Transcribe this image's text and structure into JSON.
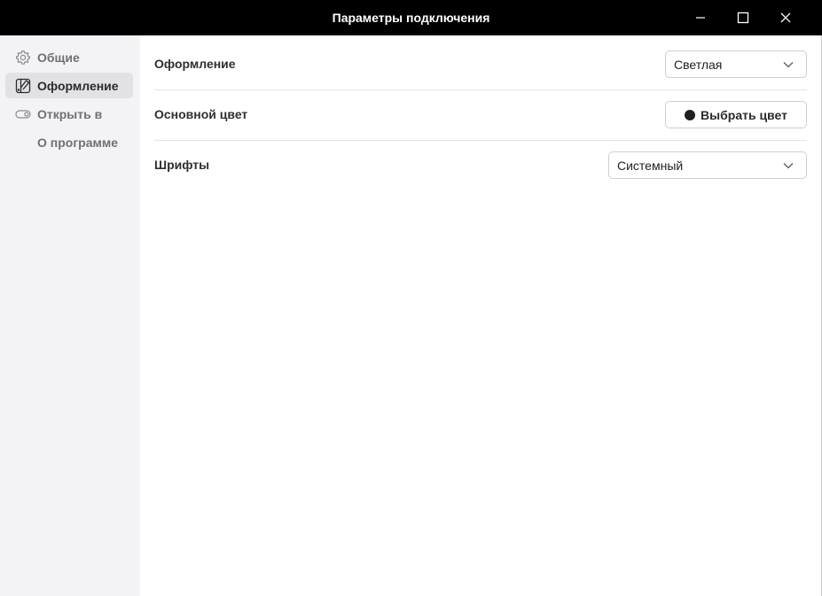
{
  "window": {
    "title": "Параметры подключения",
    "controls": {
      "minimize": "minimize-icon",
      "maximize": "maximize-icon",
      "close": "close-icon"
    }
  },
  "sidebar": {
    "items": [
      {
        "label": "Общие",
        "icon": "gear-icon",
        "active": false
      },
      {
        "label": "Оформление",
        "icon": "palette-icon",
        "active": true
      },
      {
        "label": "Открыть в",
        "icon": "toggle-icon",
        "active": false
      },
      {
        "label": "О программе",
        "icon": "",
        "active": false
      }
    ]
  },
  "settings": {
    "appearance": {
      "label": "Оформление",
      "value": "Светлая"
    },
    "accent_color": {
      "label": "Основной цвет",
      "button_label": "Выбрать цвет",
      "color": "#1f1f1f"
    },
    "fonts": {
      "label": "Шрифты",
      "value": "Системный"
    }
  },
  "colors": {
    "titlebar": "#000000",
    "sidebar_bg": "#f3f3f5",
    "active_item_bg": "#e2e2e5"
  }
}
